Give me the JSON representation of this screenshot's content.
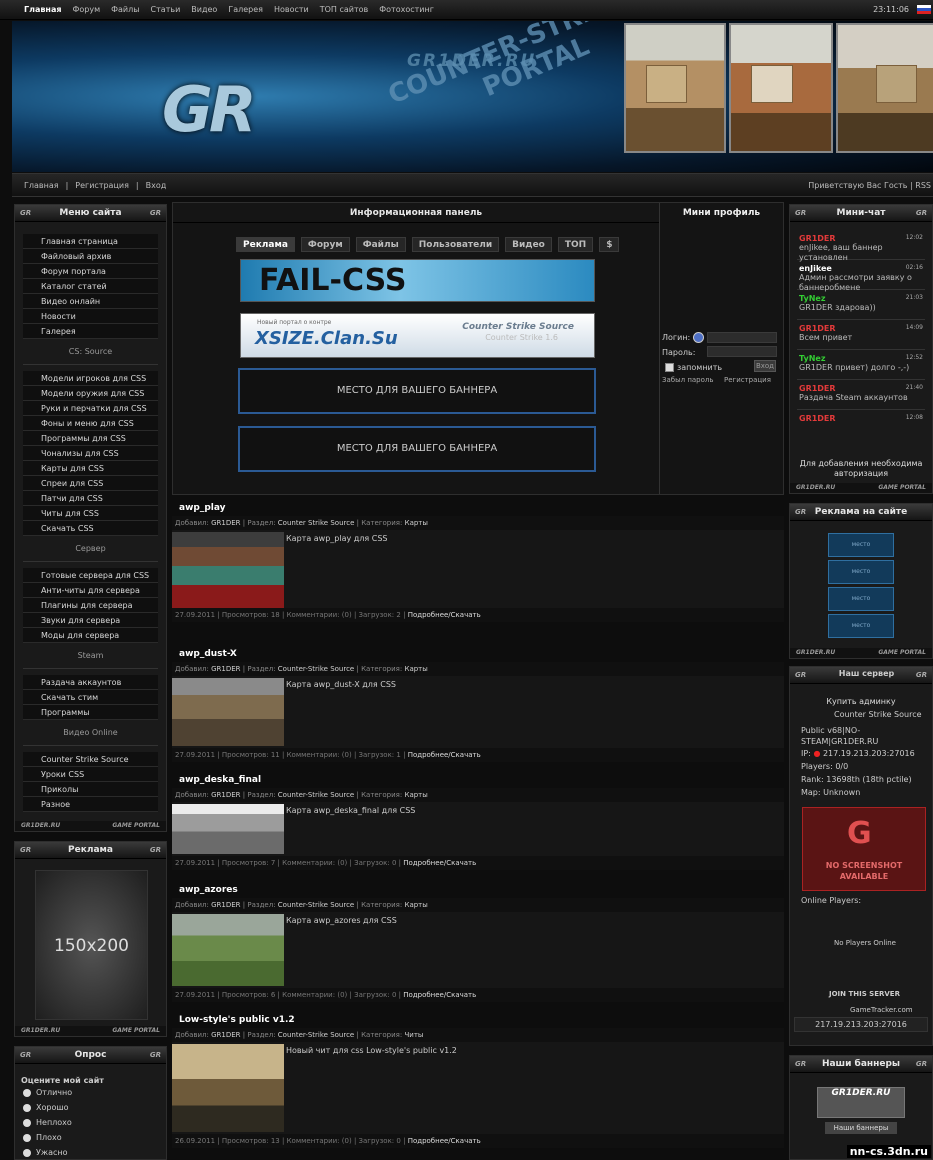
{
  "topbar": {
    "nav": [
      "Главная",
      "Форум",
      "Файлы",
      "Статьи",
      "Видео",
      "Галерея",
      "Новости",
      "ТОП сайтов",
      "Фотохостинг"
    ],
    "time": "23:11:06"
  },
  "header": {
    "logo": "GR",
    "site_name": "GR1DER.RU",
    "tagline_line1": "COUNTER-STRIKE",
    "tagline_line2": "PORTAL"
  },
  "subbar": {
    "links": [
      "Главная",
      "|",
      "Регистрация",
      "|",
      "Вход"
    ],
    "greeting": "Приветствую Вас Гость | RSS"
  },
  "left_menu": {
    "title": "Меню сайта",
    "group1": [
      "Главная страница",
      "Файловый архив",
      "Форум портала",
      "Каталог статей",
      "Видео онлайн",
      "Новости",
      "Галерея"
    ],
    "section2_title": "CS: Source",
    "group2": [
      "Модели игроков для CSS",
      "Модели оружия для CSS",
      "Руки и перчатки для CSS",
      "Фоны и меню для CSS",
      "Программы для CSS",
      "Чонализы для CSS",
      "Карты для CSS",
      "Спреи для CSS",
      "Патчи для CSS",
      "Читы для CSS",
      "Скачать CSS"
    ],
    "section3_title": "Сервер",
    "group3": [
      "Готовые сервера для CSS",
      "Анти-читы для сервера",
      "Плагины для сервера",
      "Звуки для сервера",
      "Моды для сервера"
    ],
    "section4_title": "Steam",
    "group4": [
      "Раздача аккаунтов",
      "Скачать стим",
      "Программы"
    ],
    "section5_title": "Видео Online",
    "group5": [
      "Counter Strike Source",
      "Уроки CSS",
      "Приколы",
      "Разное"
    ],
    "footer_left": "GR1DER.RU",
    "footer_right": "GAME PORTAL"
  },
  "left_ad": {
    "title": "Реклама",
    "placeholder": "150x200",
    "footer_left": "GR1DER.RU",
    "footer_right": "GAME PORTAL"
  },
  "poll": {
    "title": "Опрос",
    "question": "Оцените мой сайт",
    "options": [
      "Отлично",
      "Хорошо",
      "Неплохо",
      "Плохо",
      "Ужасно"
    ]
  },
  "info_panel": {
    "title": "Информационная панель",
    "tabs": [
      "Реклама",
      "Форум",
      "Файлы",
      "Пользователи",
      "Видео",
      "ТОП",
      "$"
    ],
    "banner1": "FAIL-CSS",
    "banner2_small": "Новый портал о контре",
    "banner2_main": "XSIZE.Clan.Su",
    "banner2_right": "Counter Strike Source",
    "banner2_right_sub": "Counter Strike 1.6",
    "slot1": "МЕСТО ДЛЯ ВАШЕГО БАННЕРА",
    "slot2": "МЕСТО ДЛЯ ВАШЕГО БАННЕРА"
  },
  "mini_profile": {
    "title": "Мини профиль",
    "login_label": "Логин:",
    "password_label": "Пароль:",
    "remember": "запомнить",
    "submit": "Вход",
    "forgot": "Забыл пароль",
    "register": "Регистрация"
  },
  "news": [
    {
      "title": "awp_play",
      "author": "GR1DER",
      "section": "Counter Strike Source",
      "category": "Карты",
      "desc": "Карта awp_play для CSS",
      "date": "27.09.2011",
      "views": "18",
      "comments": "0",
      "downloads": "2",
      "more": "Подробнее/Скачать"
    },
    {
      "title": "awp_dust-X",
      "author": "GR1DER",
      "section": "Counter-Strike Source",
      "category": "Карты",
      "desc": "Карта awp_dust-X для CSS",
      "date": "27.09.2011",
      "views": "11",
      "comments": "0",
      "downloads": "1",
      "more": "Подробнее/Скачать"
    },
    {
      "title": "awp_deska_final",
      "author": "GR1DER",
      "section": "Counter-Strike Source",
      "category": "Карты",
      "desc": "Карта awp_deska_final для CSS",
      "date": "27.09.2011",
      "views": "7",
      "comments": "0",
      "downloads": "0",
      "more": "Подробнее/Скачать"
    },
    {
      "title": "awp_azores",
      "author": "GR1DER",
      "section": "Counter-Strike Source",
      "category": "Карты",
      "desc": "Карта awp_azores для CSS",
      "date": "27.09.2011",
      "views": "6",
      "comments": "0",
      "downloads": "0",
      "more": "Подробнее/Скачать"
    },
    {
      "title": "Low-style's public v1.2",
      "author": "GR1DER",
      "section": "Counter-Strike Source",
      "category": "Читы",
      "desc": "Новый чит для css Low-style's public v1.2",
      "date": "26.09.2011",
      "views": "13",
      "comments": "0",
      "downloads": "0",
      "more": "Подробнее/Скачать"
    }
  ],
  "news_labels": {
    "added": "Добавил:",
    "section": "Раздел:",
    "category": "Категория:",
    "views": "Просмотров:",
    "comments": "Комментарии:",
    "downloads": "Загрузок:"
  },
  "mini_chat": {
    "title": "Мини-чат",
    "messages": [
      {
        "name": "GR1DER",
        "color": "#e23a3a",
        "time": "12:02",
        "text": "enJikee, ваш баннер установлен"
      },
      {
        "name": "enJikee",
        "color": "#ffffff",
        "time": "02:16",
        "text": "Админ рассмотри заявку о баннеробмене"
      },
      {
        "name": "TyNez",
        "color": "#33cc33",
        "time": "21:03",
        "text": "GR1DER здарова))"
      },
      {
        "name": "GR1DER",
        "color": "#e23a3a",
        "time": "14:09",
        "text": "Всем привет"
      },
      {
        "name": "TyNez",
        "color": "#33cc33",
        "time": "12:52",
        "text": "GR1DER привет) долго -,-)"
      },
      {
        "name": "GR1DER",
        "color": "#e23a3a",
        "time": "21:40",
        "text": "Раздача Steam аккаунтов"
      },
      {
        "name": "GR1DER",
        "color": "#e23a3a",
        "time": "12:08",
        "text": ""
      }
    ],
    "note": "Для добавления необходима авторизация",
    "footer_left": "GR1DER.RU",
    "footer_right": "GAME PORTAL"
  },
  "right_ads": {
    "title": "Реклама на сайте",
    "slot_label": "место",
    "footer_left": "GR1DER.RU",
    "footer_right": "GAME PORTAL"
  },
  "server": {
    "title": "Наш сервер",
    "buy": "Купить админку",
    "game": "Counter Strike Source",
    "name": "Public v68|NO-STEAM|GR1DER.RU",
    "ip_label": "IP:",
    "ip": "217.19.213.203:27016",
    "players_label": "Players:",
    "players": "0/0",
    "rank_label": "Rank:",
    "rank": "13698th (18th pctile)",
    "map_label": "Map:",
    "map": "Unknown",
    "no_screenshot": "NO SCREENSHOT AVAILABLE",
    "online_label": "Online Players:",
    "no_players": "No Players Online",
    "join": "JOIN THIS SERVER",
    "tracker": "GameTracker.com",
    "address": "217.19.213.203:27016"
  },
  "our_banners": {
    "title": "Наши баннеры",
    "banner": "GR1DER.RU",
    "caption": "Наши баннеры"
  },
  "watermark": "nn-cs.3dn.ru"
}
